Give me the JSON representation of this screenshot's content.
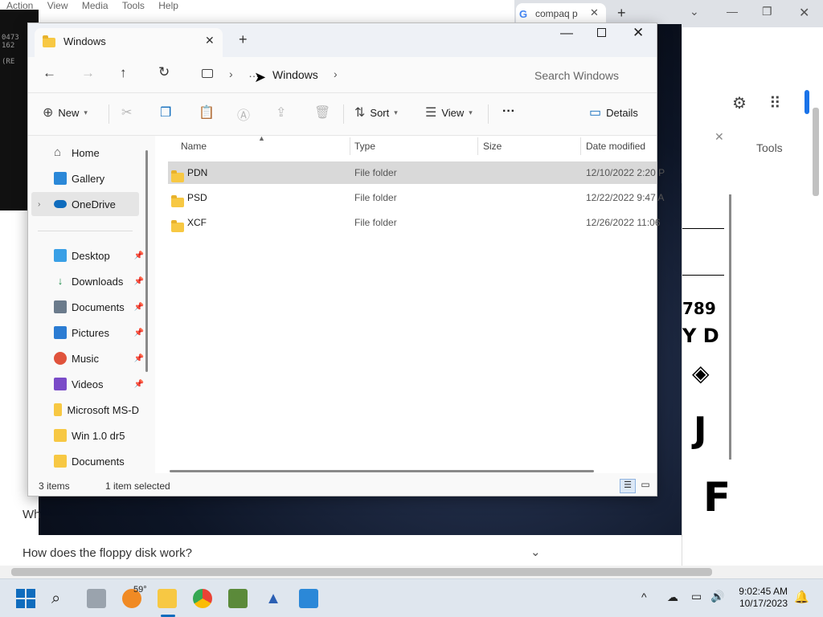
{
  "background": {
    "menubar": [
      "Action",
      "View",
      "Media",
      "Tools",
      "Help"
    ],
    "chrome_tab_title": "compaq p",
    "tools_label": "Tools",
    "faq_question": "How does the floppy disk work?",
    "faq_partial": "Wh",
    "terminal_lines": [
      "0473",
      "162",
      "(RE"
    ],
    "chart_glyphs": [
      "789",
      "Y D",
      "J",
      "F"
    ]
  },
  "explorer": {
    "tab_title": "Windows",
    "breadcrumb": [
      "Windows"
    ],
    "search_placeholder": "Search Windows",
    "toolbar": {
      "new": "New",
      "sort": "Sort",
      "view": "View",
      "more": "···",
      "details": "Details"
    },
    "nav": {
      "home": "Home",
      "gallery": "Gallery",
      "onedrive": "OneDrive",
      "quick_access": [
        {
          "label": "Desktop",
          "icon": "desktop-icon",
          "pinned": true
        },
        {
          "label": "Downloads",
          "icon": "downloads-icon",
          "pinned": true
        },
        {
          "label": "Documents",
          "icon": "documents-icon",
          "pinned": true
        },
        {
          "label": "Pictures",
          "icon": "pictures-icon",
          "pinned": true
        },
        {
          "label": "Music",
          "icon": "music-icon",
          "pinned": true
        },
        {
          "label": "Videos",
          "icon": "videos-icon",
          "pinned": true
        },
        {
          "label": "Microsoft MS-D",
          "icon": "folder-icon",
          "pinned": false
        },
        {
          "label": "Win 1.0 dr5",
          "icon": "folder-icon",
          "pinned": false
        },
        {
          "label": "Documents",
          "icon": "folder-icon",
          "pinned": false
        }
      ]
    },
    "columns": [
      "Name",
      "Type",
      "Size",
      "Date modified"
    ],
    "files": [
      {
        "name": "PDN",
        "type": "File folder",
        "size": "",
        "date": "12/10/2022 2:20 P",
        "selected": true
      },
      {
        "name": "PSD",
        "type": "File folder",
        "size": "",
        "date": "12/22/2022 9:47 A",
        "selected": false
      },
      {
        "name": "XCF",
        "type": "File folder",
        "size": "",
        "date": "12/26/2022 11:06",
        "selected": false
      }
    ],
    "status": {
      "count": "3 items",
      "selected": "1 item selected"
    }
  },
  "taskbar": {
    "weather_temp": "59°",
    "time": "9:02:45 AM",
    "date": "10/17/2023"
  },
  "colors": {
    "folder": "#f7c843",
    "selected_row": "#d9d9d9",
    "onedrive_blue": "#0f6cbd",
    "taskbar": "#dfe6ee"
  }
}
